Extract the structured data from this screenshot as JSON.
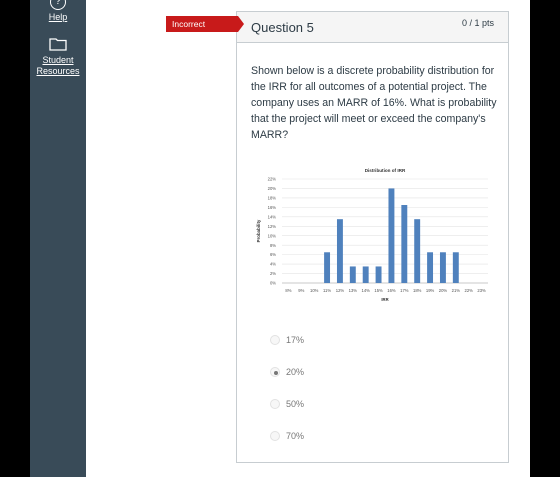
{
  "sidebar": {
    "help_label": "Help",
    "student_resources_label": "Student Resources"
  },
  "status_badge": "Incorrect",
  "question": {
    "title": "Question 5",
    "points": "0 / 1 pts",
    "text": "Shown below is a discrete probability distribution for the IRR for all outcomes of a potential project. The company uses an MARR of 16%. What is probability that the project will meet or exceed the company's MARR?"
  },
  "answers": [
    {
      "label": "17%",
      "selected": false
    },
    {
      "label": "20%",
      "selected": true
    },
    {
      "label": "50%",
      "selected": false
    },
    {
      "label": "70%",
      "selected": false
    }
  ],
  "chart_data": {
    "type": "bar",
    "title": "Distribution of IRR",
    "xlabel": "IRR",
    "ylabel": "Probability",
    "categories": [
      "8%",
      "9%",
      "10%",
      "11%",
      "12%",
      "13%",
      "14%",
      "15%",
      "16%",
      "17%",
      "18%",
      "19%",
      "20%",
      "21%",
      "22%",
      "23%"
    ],
    "values": [
      0,
      0,
      0,
      6.5,
      13.5,
      3.5,
      3.5,
      3.5,
      20,
      16.5,
      13.5,
      6.5,
      6.5,
      6.5,
      0,
      0
    ],
    "yticks": [
      "0%",
      "2%",
      "4%",
      "6%",
      "8%",
      "10%",
      "12%",
      "14%",
      "16%",
      "18%",
      "20%",
      "22%"
    ],
    "ylim": [
      0,
      22
    ],
    "grid": true,
    "bar_color": "#4f81bd"
  }
}
